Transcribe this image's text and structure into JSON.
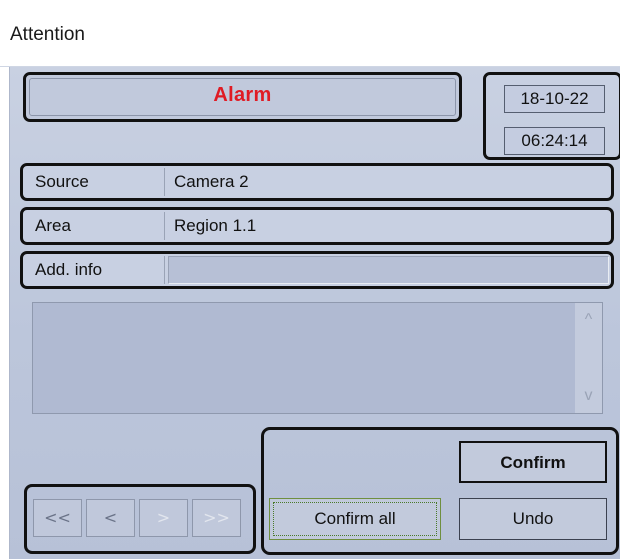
{
  "window": {
    "title": "Attention"
  },
  "alarm": {
    "label": "Alarm",
    "color": "#e01b24"
  },
  "datetime": {
    "date": "18-10-22",
    "time": "06:24:14"
  },
  "fields": [
    {
      "label": "Source",
      "value": "Camera 2"
    },
    {
      "label": "Area",
      "value": "Region 1.1"
    },
    {
      "label": "Add. info",
      "value": ""
    }
  ],
  "memo": {
    "text": "",
    "scroll_up": "^",
    "scroll_down": "v"
  },
  "navigation": {
    "first": "<<",
    "prev": "<",
    "next": ">",
    "last": ">>"
  },
  "actions": {
    "confirm": "Confirm",
    "confirm_all": "Confirm all",
    "undo": "Undo"
  }
}
